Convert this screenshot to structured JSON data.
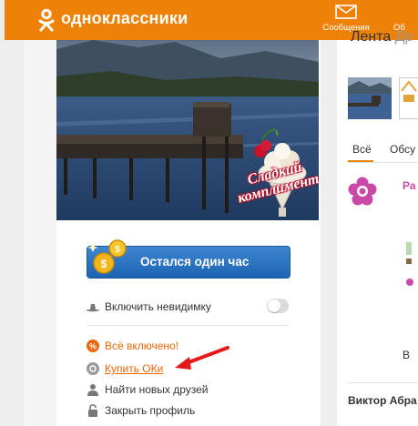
{
  "header": {
    "brand": "одноклассники",
    "nav": {
      "messages": "Сообщения",
      "other": "Об"
    }
  },
  "photo": {
    "caption_line1": "Сладкий",
    "caption_line2": "комплимент"
  },
  "promo": {
    "label": "Остался один час"
  },
  "menu": {
    "invisible": "Включить невидимку",
    "all_inclusive": "Всё включено!",
    "buy_oki": "Купить ОКи",
    "find_friends": "Найти новых друзей",
    "close_profile": "Закрыть профиль"
  },
  "right": {
    "feed_tabs": [
      "Лента",
      "Др"
    ],
    "filters": [
      "Всё",
      "Обсу"
    ],
    "poster_initial": "Ра",
    "misc_initial": "В",
    "user_name": "Виктор Абра"
  },
  "colors": {
    "brand": "#ee8208",
    "link": "#ee6608",
    "promo": "#1d64b3",
    "arrow": "#e3191b"
  }
}
